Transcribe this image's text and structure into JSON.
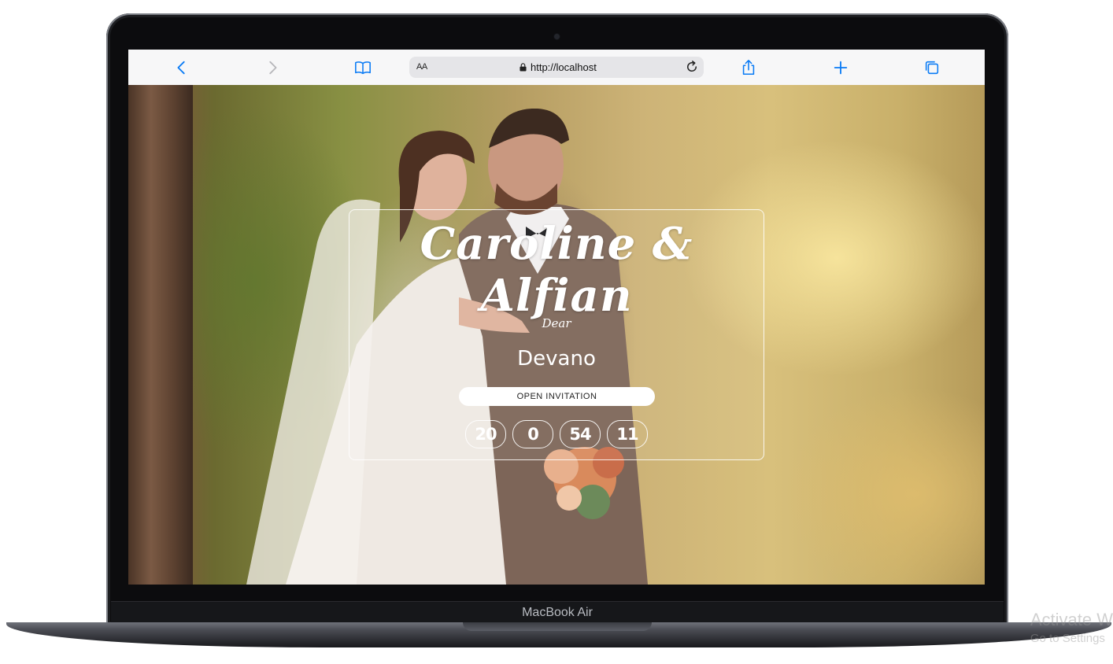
{
  "device": {
    "label": "MacBook Air"
  },
  "browser": {
    "address_prefix": "AA",
    "url": "http://localhost",
    "icons": [
      "back-icon",
      "forward-icon",
      "bookmarks-icon",
      "lock-icon",
      "reload-icon",
      "share-icon",
      "new-tab-icon",
      "tabs-icon"
    ]
  },
  "invitation": {
    "couple": "Caroline & Alfian",
    "dear_label": "Dear",
    "guest_name": "Devano",
    "open_button": "OPEN INVITATION",
    "countdown": [
      "20",
      "0",
      "54",
      "11"
    ]
  },
  "watermark": {
    "line1": "Activate W",
    "line2": "Go to Settings"
  }
}
